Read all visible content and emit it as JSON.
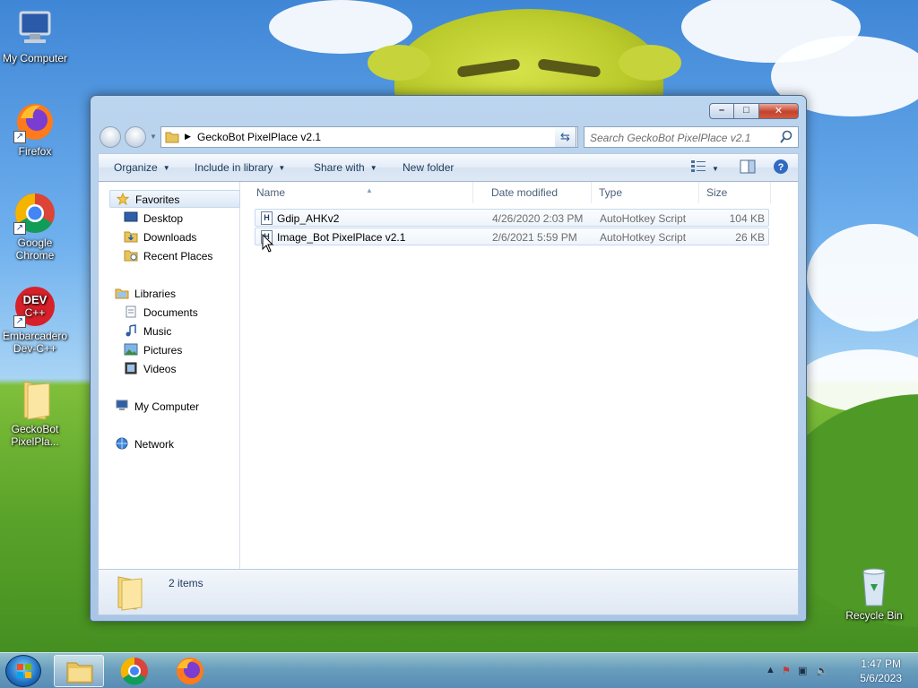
{
  "desktop": {
    "icons": [
      {
        "label": "My Computer",
        "icon": "computer-icon"
      },
      {
        "label": "Firefox",
        "icon": "firefox-icon"
      },
      {
        "label": "Google Chrome",
        "icon": "chrome-icon"
      },
      {
        "label": "Embarcadero Dev-C++",
        "icon": "devcpp-icon"
      },
      {
        "label": "GeckoBot PixelPla...",
        "icon": "folder-icon"
      },
      {
        "label": "Recycle Bin",
        "icon": "recycle-bin-icon"
      }
    ]
  },
  "window": {
    "controls": {
      "minimize": "–",
      "maximize": "□",
      "close": "✕"
    },
    "address": {
      "crumb": "GeckoBot PixelPlace v2.1"
    },
    "search": {
      "placeholder": "Search GeckoBot PixelPlace v2.1"
    },
    "toolbar": {
      "organize": "Organize",
      "include": "Include in library",
      "share": "Share with",
      "new_folder": "New folder"
    },
    "nav": {
      "favorites": "Favorites",
      "desktop": "Desktop",
      "downloads": "Downloads",
      "recent": "Recent Places",
      "libraries": "Libraries",
      "documents": "Documents",
      "music": "Music",
      "pictures": "Pictures",
      "videos": "Videos",
      "computer": "My Computer",
      "network": "Network"
    },
    "columns": {
      "name": "Name",
      "date": "Date modified",
      "type": "Type",
      "size": "Size"
    },
    "files": [
      {
        "name": "Gdip_AHKv2",
        "date": "4/26/2020 2:03 PM",
        "type": "AutoHotkey Script",
        "size": "104 KB"
      },
      {
        "name": "Image_Bot PixelPlace v2.1",
        "date": "2/6/2021 5:59 PM",
        "type": "AutoHotkey Script",
        "size": "26 KB"
      }
    ],
    "status": {
      "count": "2 items"
    }
  },
  "taskbar": {
    "clock": {
      "time": "1:47 PM",
      "date": "5/6/2023"
    }
  },
  "colors": {
    "accent": "#1e395b",
    "window_frame": "#bcd5ef"
  }
}
